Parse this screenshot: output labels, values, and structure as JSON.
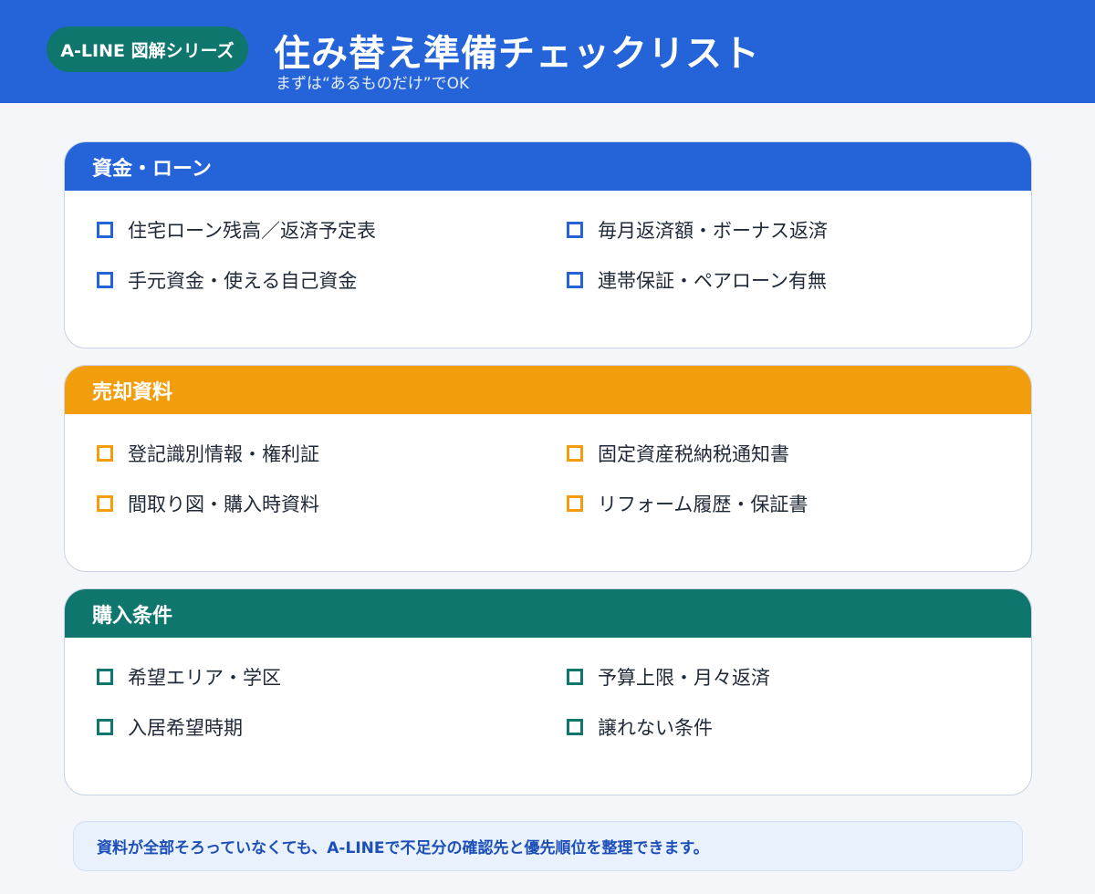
{
  "header": {
    "series_label": "A-LINE 図解シリーズ",
    "title": "住み替え準備チェックリスト",
    "subtitle": "まずは“あるものだけ”でOK"
  },
  "sections": [
    {
      "title": "資金・ローン",
      "color": "#2563d9",
      "items": [
        "住宅ローン残高／返済予定表",
        "毎月返済額・ボーナス返済",
        "手元資金・使える自己資金",
        "連帯保証・ペアローン有無"
      ]
    },
    {
      "title": "売却資料",
      "color": "#f29d0c",
      "items": [
        "登記識別情報・権利証",
        "固定資産税納税通知書",
        "間取り図・購入時資料",
        "リフォーム履歴・保証書"
      ]
    },
    {
      "title": "購入条件",
      "color": "#0f766e",
      "items": [
        "希望エリア・学区",
        "予算上限・月々返済",
        "入居希望時期",
        "譲れない条件"
      ]
    }
  ],
  "footer": {
    "note": "資料が全部そろっていなくても、A-LINEで不足分の確認先と優先順位を整理できます。"
  },
  "icons": {
    "checkbox": "checkbox-icon"
  }
}
